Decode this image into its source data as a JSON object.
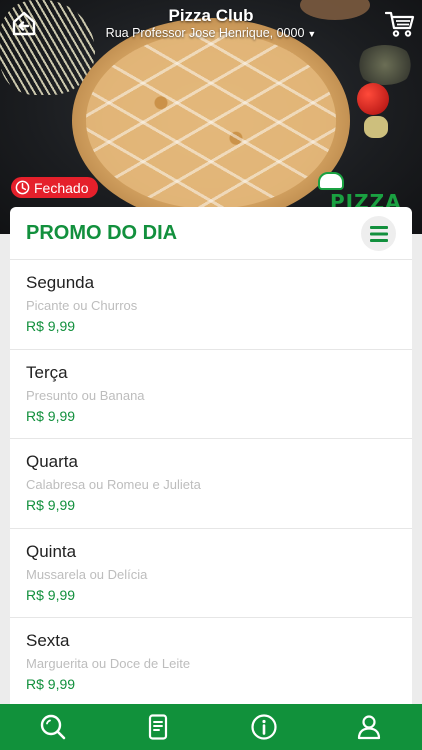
{
  "header": {
    "title": "Pizza Club",
    "address": "Rua Professor Jose Henrique, 0000",
    "back_icon": "back-home-icon",
    "cart_icon": "cart-icon"
  },
  "status": {
    "label": "Fechado",
    "icon": "clock-icon",
    "color": "#e5202b"
  },
  "logo_text": "PIZZA",
  "section": {
    "title": "PROMO DO DIA",
    "menu_icon": "menu-icon"
  },
  "days": [
    {
      "name": "Segunda",
      "desc": "Picante ou Churros",
      "price": "R$ 9,99"
    },
    {
      "name": "Terça",
      "desc": "Presunto ou Banana",
      "price": "R$ 9,99"
    },
    {
      "name": "Quarta",
      "desc": "Calabresa ou Romeu e Julieta",
      "price": "R$ 9,99"
    },
    {
      "name": "Quinta",
      "desc": "Mussarela ou Delícia",
      "price": "R$ 9,99"
    },
    {
      "name": "Sexta",
      "desc": "Marguerita ou Doce de Leite",
      "price": "R$ 9,99"
    }
  ],
  "bottom_nav": [
    {
      "icon": "search-icon"
    },
    {
      "icon": "order-icon"
    },
    {
      "icon": "info-icon"
    },
    {
      "icon": "profile-icon"
    }
  ],
  "colors": {
    "brand_green": "#12903d",
    "nav_green": "#11913b",
    "closed_red": "#e5202b"
  }
}
